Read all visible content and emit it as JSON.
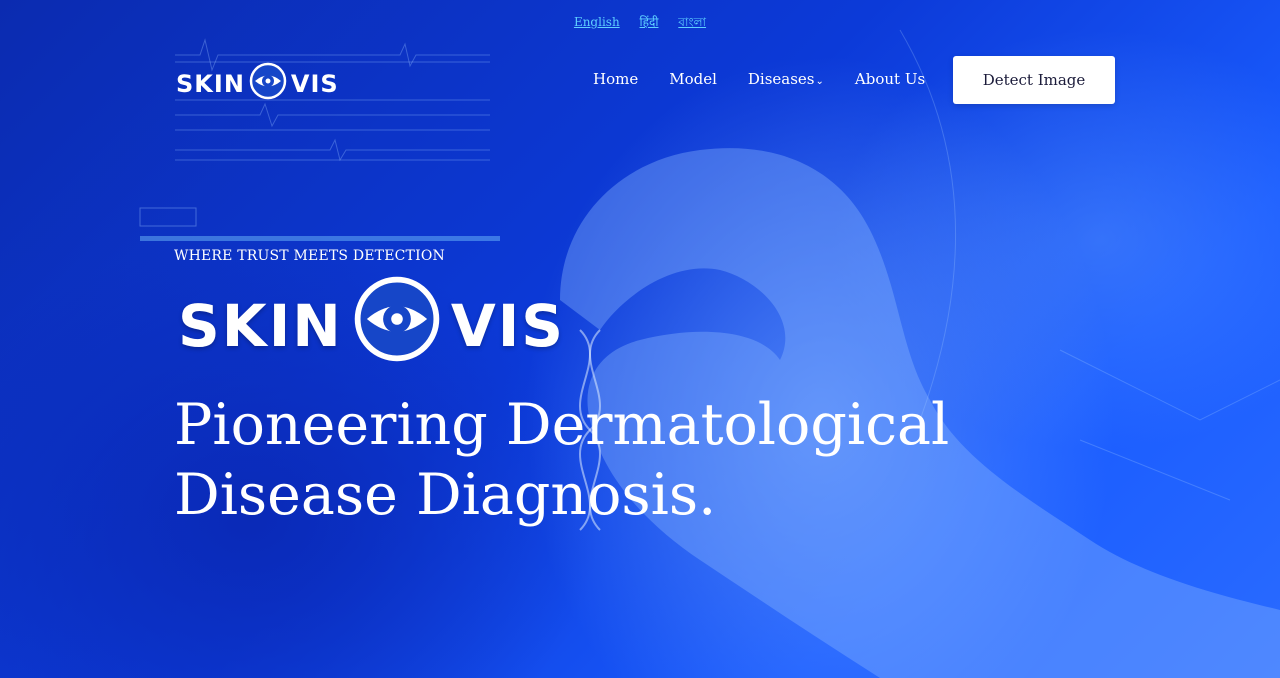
{
  "languages": [
    "English",
    "हिंदी",
    "বাংলা"
  ],
  "brand": {
    "left": "SKIN",
    "right": "VIS"
  },
  "nav": {
    "home": "Home",
    "model": "Model",
    "diseases": "Diseases",
    "about": "About Us"
  },
  "cta": {
    "detect_label": "Detect Image"
  },
  "hero": {
    "tagline": "WHERE TRUST MEETS DETECTION",
    "brand_left": "SKIN",
    "brand_right": "VIS",
    "headline_line1": "Pioneering Dermatological",
    "headline_line2": "Disease Diagnosis."
  },
  "colors": {
    "link": "#5fd0ff",
    "background": "#0c3ad8",
    "button_bg": "#ffffff"
  },
  "icons": {
    "logo": "eye-icon",
    "dropdown": "chevron-down-icon"
  }
}
